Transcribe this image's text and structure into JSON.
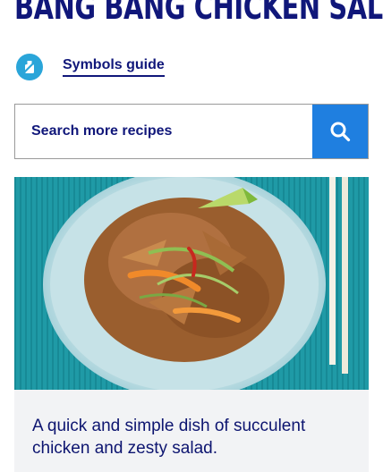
{
  "recipe": {
    "title": "BANG BANG CHICKEN SALAD",
    "description": "A quick and simple dish of succulent chicken and zesty salad."
  },
  "symbols": {
    "link_label": "Symbols guide",
    "icon": "symbols-guide-icon"
  },
  "search": {
    "placeholder": "Search more recipes",
    "button_icon": "search-icon"
  },
  "image": {
    "subject": "recipe-photo"
  },
  "colors": {
    "brand_navy": "#10177a",
    "search_blue": "#1f7fe0",
    "symbol_blue": "#2aa5d9",
    "card_bg": "#f2f3f5"
  }
}
